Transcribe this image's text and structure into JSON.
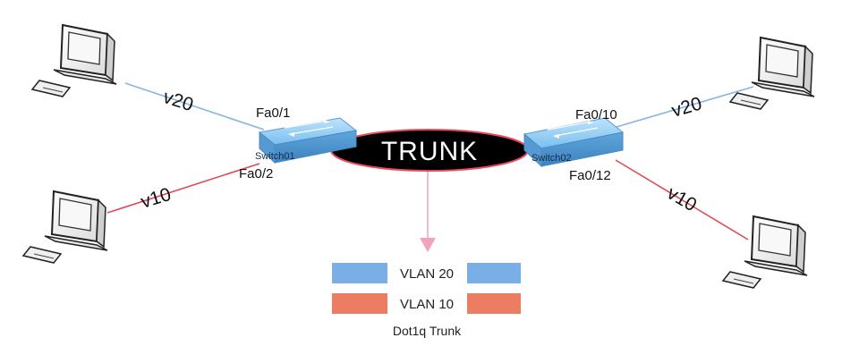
{
  "diagram": {
    "trunk_label": "TRUNK",
    "switches": [
      {
        "name": "Switch01"
      },
      {
        "name": "Switch02"
      }
    ],
    "ports": {
      "sw1_upper": "Fa0/1",
      "sw1_lower": "Fa0/2",
      "sw2_upper": "Fa0/10",
      "sw2_lower": "Fa0/12"
    },
    "links": {
      "top_left_vlan": "v20",
      "bottom_left_vlan": "v10",
      "top_right_vlan": "v20",
      "bottom_right_vlan": "v10"
    },
    "legend": {
      "vlan20": "VLAN 20",
      "vlan10": "VLAN 10",
      "caption": "Dot1q Trunk"
    },
    "colors": {
      "vlan20": "#7aaee6",
      "vlan10": "#ec7d63",
      "trunk": "#000000",
      "trunk_outline": "#e8495d",
      "switch": "#71b6e6",
      "arrow": "#f3a2be"
    }
  }
}
